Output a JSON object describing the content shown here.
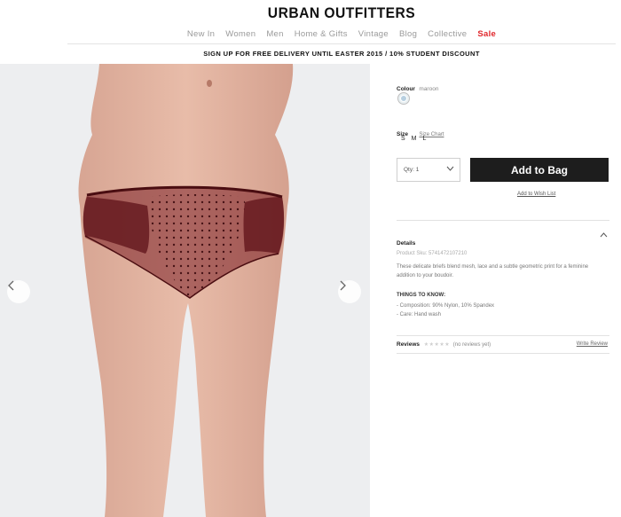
{
  "brand": {
    "logo": "URBAN OUTFITTERS"
  },
  "nav": {
    "items": [
      "New In",
      "Women",
      "Men",
      "Home & Gifts",
      "Vintage",
      "Blog",
      "Collective",
      "Sale"
    ]
  },
  "promo": {
    "text": "SIGN UP FOR FREE DELIVERY UNTIL EASTER 2015 / 10% STUDENT DISCOUNT"
  },
  "product": {
    "colour_label": "Colour",
    "colour_value": "maroon",
    "size_label": "Size",
    "size_chart": "Size Chart",
    "sizes": [
      "S",
      "M",
      "L"
    ],
    "qty": "Qty: 1",
    "add_to_bag": "Add to Bag",
    "wish_list": "Add to Wish List",
    "details_label": "Details",
    "sku": "Product Sku: 5741472107210",
    "description": "These delicate briefs blend mesh, lace and a subtle geometric print for a feminine addition to your boudoir.",
    "things_title": "THINGS TO KNOW:",
    "things": [
      "- Composition: 90% Nylon, 10% Spandex",
      "- Care: Hand wash"
    ],
    "reviews_label": "Reviews",
    "reviews_stars": "★★★★★",
    "reviews_none": "(no reviews yet)",
    "write_review": "Write Review"
  },
  "icons": {
    "prev": "chevron-left-icon",
    "next": "chevron-right-icon",
    "qty_dropdown": "chevron-down-icon",
    "details_toggle": "chevron-up-icon"
  },
  "colors": {
    "sale": "#e0262b",
    "button": "#1d1d1d",
    "gallery_bg": "#edeef0",
    "garment": "#7a1d24"
  }
}
